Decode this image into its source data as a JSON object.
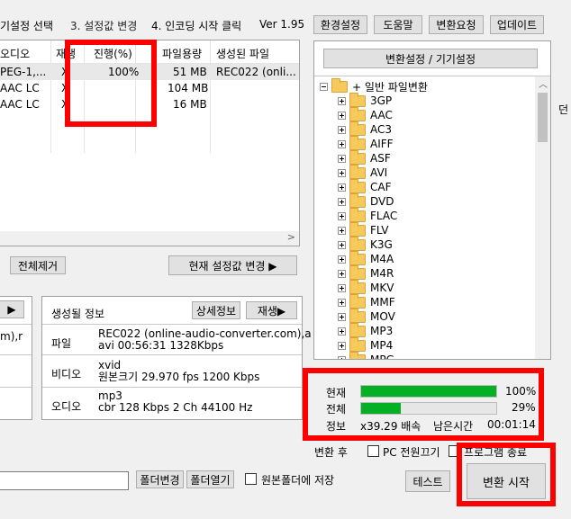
{
  "topbar": {
    "step2": "기설정 선택",
    "step3": "3. 설정값 변경",
    "step4": "4. 인코딩 시작 클릭",
    "version": "Ver 1.95",
    "buttons": [
      "환경설정",
      "도움말",
      "변환요청",
      "업데이트"
    ]
  },
  "file_list": {
    "headers": [
      "오디오",
      "재생",
      "진행(%)",
      "파일용량",
      "생성된 파일"
    ],
    "rows": [
      {
        "audio": "PEG-1,...",
        "play": "X",
        "progress": "100%",
        "size": "51 MB",
        "output": "REC022 (onli..."
      },
      {
        "audio": "AAC LC",
        "play": "X",
        "progress": "",
        "size": "104 MB",
        "output": ""
      },
      {
        "audio": "AAC LC",
        "play": "X",
        "progress": "",
        "size": "16 MB",
        "output": ""
      }
    ],
    "remove_all": "전체제거",
    "change_settings": "현재 설정값 변경 ▶"
  },
  "settings_panel": {
    "title": "변환설정 / 기기설정",
    "root": "+ 일반 파일변환",
    "formats": [
      "3GP",
      "AAC",
      "AC3",
      "AIFF",
      "ASF",
      "AVI",
      "CAF",
      "DVD",
      "FLAC",
      "FLV",
      "K3G",
      "M4A",
      "M4R",
      "MKV",
      "MMF",
      "MOV",
      "MP3",
      "MP4",
      "MPG"
    ]
  },
  "side_char": "던",
  "left_panel": {
    "play_btn": "▶",
    "text": "m),r"
  },
  "output_info": {
    "title": "생성될 정보",
    "detail_btn": "상세정보",
    "play_btn": "재생▶",
    "file_label": "파일",
    "file_line1": "REC022 (online-audio-converter.com),a",
    "file_line2": "avi  00:56:31  1328Kbps",
    "video_label": "비디오",
    "video_line1": "xvid",
    "video_line2": "원본크기  29.970 fps   1200 Kbps",
    "audio_label": "오디오",
    "audio_line1": "mp3",
    "audio_line2": "cbr    128 Kbps  2 Ch   44100 Hz"
  },
  "progress": {
    "current_label": "현재",
    "current_value": "100%",
    "current_fraction": 1.0,
    "total_label": "전체",
    "total_value": "29%",
    "total_fraction": 0.29,
    "info_label": "정보",
    "speed": "x39.29 배속",
    "remaining_label": "남은시간",
    "remaining": "00:01:14"
  },
  "after_convert": {
    "label": "변환 후",
    "pc_off": "PC 전원끄기",
    "program_exit": "프로그램 종료"
  },
  "bottom": {
    "folder_change": "폴더변경",
    "folder_open": "폴더열기",
    "save_original": "원본폴더에 저장",
    "test": "테스트",
    "start": "변환 시작"
  }
}
